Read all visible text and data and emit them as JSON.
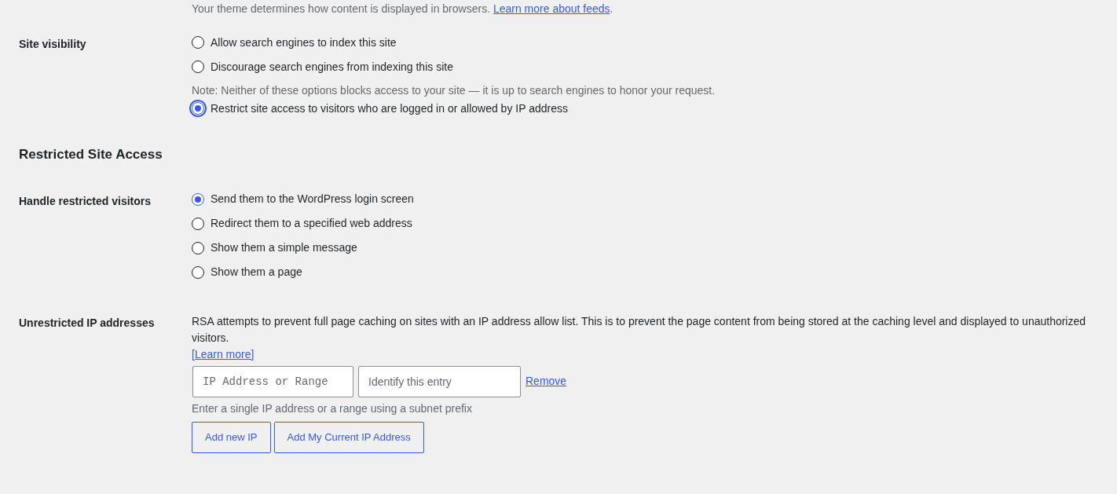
{
  "top_note": {
    "text": "Your theme determines how content is displayed in browsers.",
    "link": "Learn more about feeds",
    "after": "."
  },
  "site_visibility": {
    "label": "Site visibility",
    "options": [
      {
        "label": "Allow search engines to index this site",
        "selected": false,
        "focused": false
      },
      {
        "label": "Discourage search engines from indexing this site",
        "selected": false,
        "focused": false
      }
    ],
    "note": "Note: Neither of these options blocks access to your site — it is up to search engines to honor your request.",
    "restrict_option": {
      "label": "Restrict site access to visitors who are logged in or allowed by IP address",
      "selected": true,
      "focused": true
    }
  },
  "section_title": "Restricted Site Access",
  "handle_visitors": {
    "label": "Handle restricted visitors",
    "options": [
      {
        "label": "Send them to the WordPress login screen",
        "selected": true
      },
      {
        "label": "Redirect them to a specified web address",
        "selected": false
      },
      {
        "label": "Show them a simple message",
        "selected": false
      },
      {
        "label": "Show them a page",
        "selected": false
      }
    ]
  },
  "unrestricted_ips": {
    "label": "Unrestricted IP addresses",
    "description": "RSA attempts to prevent full page caching on sites with an IP address allow list. This is to prevent the page content from being stored at the caching level and displayed to unauthorized visitors.",
    "learn_more": "[Learn more]",
    "ip_placeholder": "IP Address or Range",
    "entry_placeholder": "Identify this entry",
    "remove": "Remove",
    "hint": "Enter a single IP address or a range using a subnet prefix",
    "buttons": [
      "Add new IP",
      "Add My Current IP Address"
    ]
  }
}
